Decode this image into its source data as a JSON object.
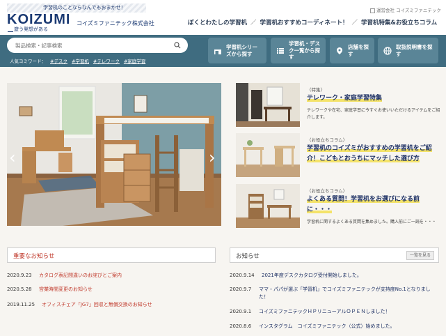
{
  "header": {
    "tagline": "学習机のことならなんでもおまかせ！",
    "logo": "KOIZUMI",
    "logo_sub": "遊う発想がある",
    "company": "コイズミファニテック株式会社",
    "utility_link": "運営会社 コイズミファニテック",
    "nav": [
      "ぼくとわたしの学習机",
      "学習机おすすめコーディネート！",
      "学習机特集&お役立ちコラム"
    ]
  },
  "search": {
    "placeholder": "製品検索・記事検索",
    "popular_label": "人気ヨミワード：",
    "keywords": [
      "#デスク",
      "#学習机",
      "#テレワーク",
      "#家庭学習"
    ]
  },
  "category_buttons": [
    {
      "label": "学習机シリーズから探す",
      "icon": "desk-icon"
    },
    {
      "label": "学習机・デスク一覧から探す",
      "icon": "list-icon"
    },
    {
      "label": "店舗を探す",
      "icon": "map-pin-icon"
    },
    {
      "label": "取扱説明書を探す",
      "icon": "globe-icon"
    }
  ],
  "slider": {
    "prev": "‹",
    "next": "›"
  },
  "features": [
    {
      "tag": "〈特集〉",
      "title": "テレワーク・家庭学習特集",
      "desc": "テレワークや在宅、家庭学習に今すぐお使いいただけるアイテムをご紹介します。"
    },
    {
      "tag": "〈お役立ちコラム〉",
      "title": "学習机のコイズミがおすすめの学習机をご紹介！こどもとおうちにマッチした選び方",
      "desc": ""
    },
    {
      "tag": "〈お役立ちコラム〉",
      "title": "よくある質問！学習机をお選びになる前に・・・",
      "desc": "学習机に関するよくある質問を集めました。購入前にご一読を・・・"
    }
  ],
  "important_news": {
    "heading": "重要なお知らせ",
    "items": [
      {
        "date": "2020.9.23",
        "text": "カタログ表記間違いのお詫びとご案内"
      },
      {
        "date": "2020.5.28",
        "text": "営業時間変更のお知らせ"
      },
      {
        "date": "2019.11.25",
        "text": "オフィスチェア「JG7」回収と無償交換のお知らせ"
      }
    ]
  },
  "news": {
    "heading": "お知らせ",
    "more": "一覧を見る",
    "items": [
      {
        "date": "2020.9.14",
        "text": "2021年度デスクカタログ受付開始しました。"
      },
      {
        "date": "2020.9.7",
        "text": "ママ・パパが選ぶ「学習机」でコイズミファニテックが支持度No.1となりました！"
      },
      {
        "date": "2020.9.1",
        "text": "コイズミファニテックＨＰリニューアルＯＰＥＮしました！"
      },
      {
        "date": "2020.8.6",
        "text": "インスタグラム　コイズミファニテック（公式）始めました。"
      }
    ]
  },
  "colors": {
    "brand": "#1b3a73",
    "band": "#3f6c80",
    "button": "#5a8597",
    "alert": "#c0392b",
    "link": "#1c2f63",
    "highlight": "#f4e36a"
  }
}
